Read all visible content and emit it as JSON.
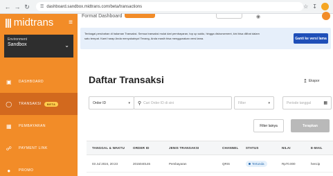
{
  "browser": {
    "url": "dashboard.sandbox.midtrans.com/beta/transactions",
    "icons": [
      "back-arrow-icon",
      "forward-arrow-icon",
      "reload-icon",
      "site-info-icon",
      "star-icon",
      "download-icon",
      "profile-avatar"
    ]
  },
  "sidebar": {
    "logo": "midtrans",
    "environment": {
      "label": "Environment",
      "value": "Sandbox"
    },
    "items": [
      {
        "label": "DASHBOARD",
        "icon": "dashboard-icon",
        "active": false
      },
      {
        "label": "TRANSAKSI",
        "icon": "transactions-icon",
        "active": true,
        "badge": "BETA"
      },
      {
        "label": "PEMBAYARAN",
        "icon": "payment-icon",
        "active": false
      },
      {
        "label": "PAYMENT LINK",
        "icon": "link-icon",
        "active": false
      },
      {
        "label": "PROMO",
        "icon": "promo-icon",
        "active": false
      }
    ],
    "colors": {
      "bg": "#f28c28",
      "active": "#d2691e",
      "env_box": "#2e2e2e"
    }
  },
  "topbar": {
    "left_text": "Format Dashboard"
  },
  "banner": {
    "lines": [
      "Tenbagai perubahan di halaman Transaksi. Semua transaksi mulai dari pembayaran, top up saldo, hingga disbursement, kini bisa dilihat dalam",
      "satu tempat. Kami harap Anda menyukainya! Tenang, Anda masih bisa menggunakan versi lama."
    ],
    "button_label": "Ganti ke versi lama",
    "colors": {
      "bg": "#e6effa",
      "button": "#1f4fb8"
    }
  },
  "main": {
    "title": "Daftar Transaksi",
    "export_label": "Ekspor",
    "filters": {
      "order_select": "Order ID",
      "search_placeholder": "Cari Order ID di sini",
      "filter_placeholder": "Filter",
      "period_placeholder": "Periode tanggal"
    },
    "buttons": {
      "more_filters": "Filter lainya",
      "apply": "Terapkan"
    },
    "table": {
      "headers": [
        "TANGGAL & WAKTU",
        "ORDER ID",
        "JENIS TRANSAKSI",
        "CHANNEL",
        "STATUS",
        "NILAI",
        "E-MAIL"
      ],
      "rows": [
        [
          "03 Jul 2024, 20:23",
          "2015040146",
          "Pembayaran",
          "QRIS",
          "Tertunda",
          "Rp70.000",
          "hencip"
        ]
      ]
    },
    "colors": {
      "status_pending": "#2b6cb0",
      "status_bg": "#e4f0fb",
      "apply_disabled": "#b9b9b9"
    }
  }
}
